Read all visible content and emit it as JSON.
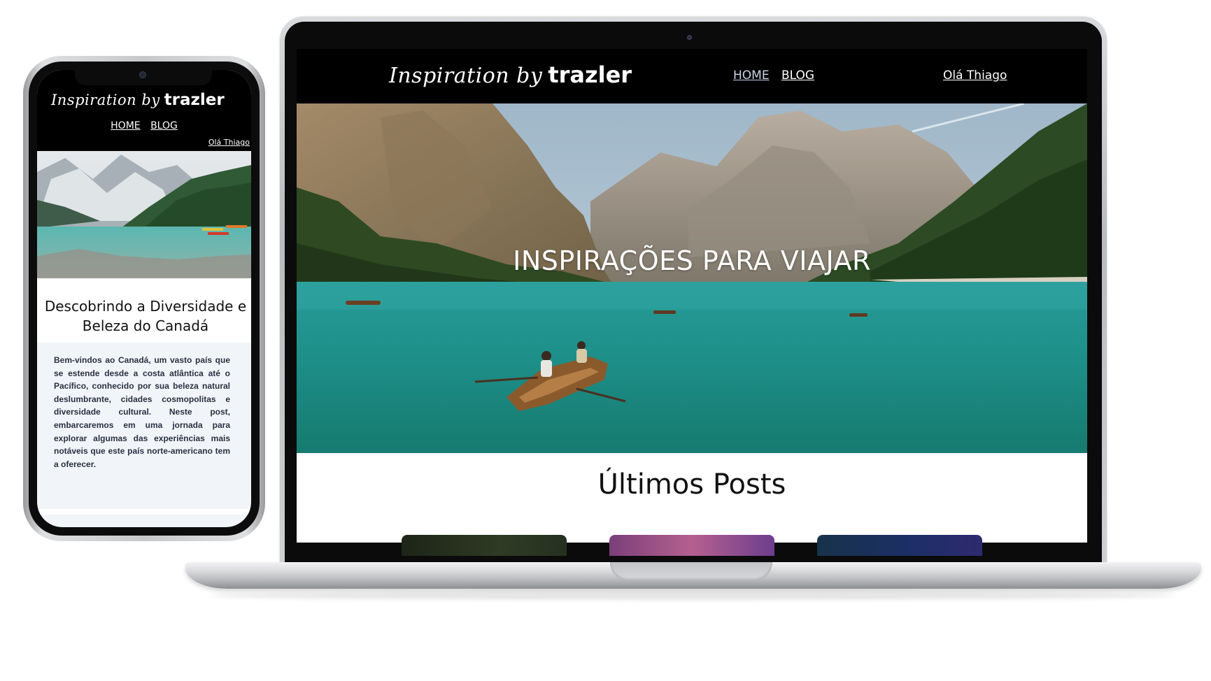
{
  "laptop": {
    "brand_script": "Inspiration by",
    "brand_word": "trazler",
    "nav": {
      "home": "HOME",
      "blog": "BLOG"
    },
    "user_greeting": "Olá Thiago",
    "hero_title": "INSPIRAÇÕES PARA VIAJAR",
    "section_title": "Últimos Posts"
  },
  "phone": {
    "brand_script": "Inspiration by",
    "brand_word": "trazler",
    "nav": {
      "home": "HOME",
      "blog": "BLOG"
    },
    "user_greeting": "Olá Thiago",
    "post_title": "Descobrindo a Diversidade e Beleza do Canadá",
    "post_body": "Bem-vindos ao Canadá, um vasto país que se estende desde a costa atlântica até o Pacífico, conhecido por sua beleza natural deslumbrante, cidades cosmopolitas e diversidade cultural. Neste post, embarcaremos em uma jornada para explorar algumas das experiências mais notáveis que este país norte-americano tem a oferecer."
  },
  "colors": {
    "header_bg": "#000000",
    "nav_active": "#c9d2e6",
    "lake": "#1f9e98",
    "body_text": "#2b3142"
  }
}
